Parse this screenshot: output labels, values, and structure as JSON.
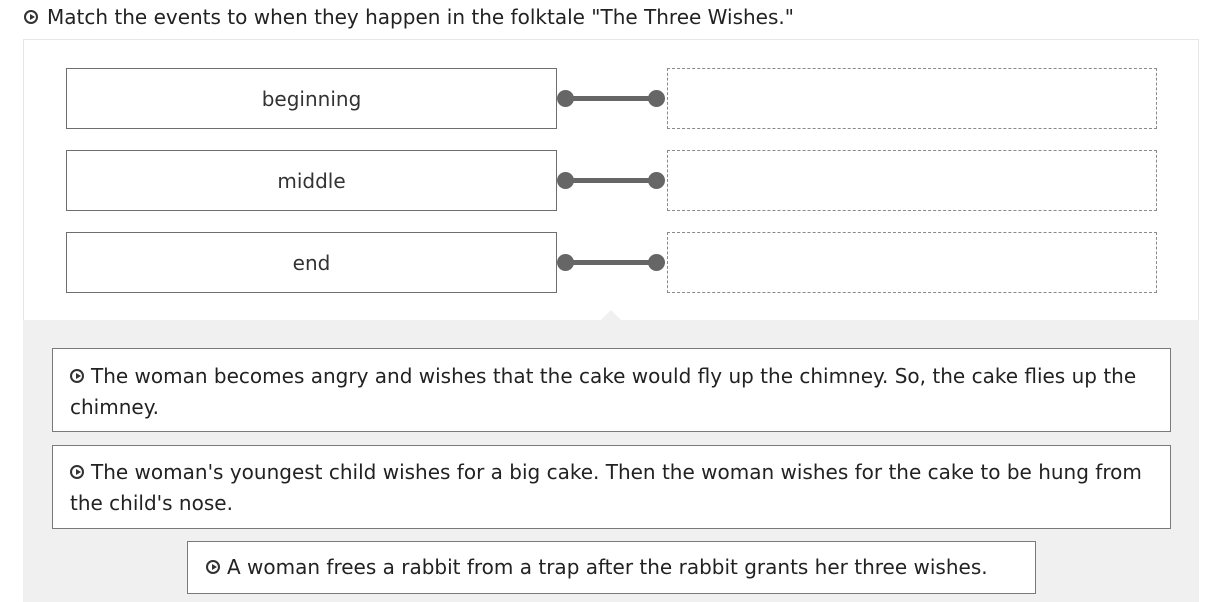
{
  "prompt": {
    "icon": "play-circle-icon",
    "text": "Match the events to when they happen in the folktale \"The Three Wishes.\""
  },
  "matches": [
    {
      "term": "beginning"
    },
    {
      "term": "middle"
    },
    {
      "term": "end"
    }
  ],
  "tiles": [
    {
      "icon": "play-circle-icon",
      "text": "The woman becomes angry and wishes that the cake would fly up the chimney. So, the cake flies up the chimney."
    },
    {
      "icon": "play-circle-icon",
      "text": "The woman's youngest child wishes for a big cake. Then the woman wishes for the cake to be hung from the child's nose."
    },
    {
      "icon": "play-circle-icon",
      "text": "A woman frees a rabbit from a trap after the rabbit grants her three wishes."
    }
  ],
  "colors": {
    "connector": "#666666",
    "tray_background": "#f0f0f0",
    "border": "#7a7a7a"
  }
}
